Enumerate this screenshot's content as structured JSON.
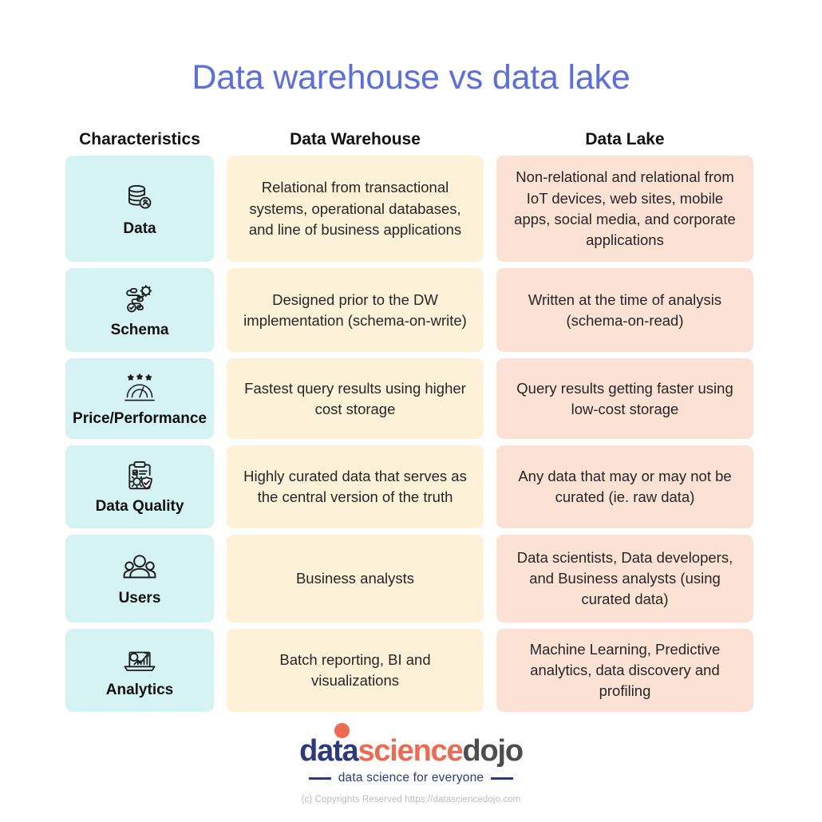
{
  "title": "Data warehouse vs data lake",
  "colors": {
    "title": "#5b6ee1",
    "characteristics_cell": "#d6f3f4",
    "data_warehouse_cell": "#fdf1d8",
    "data_lake_cell": "#fbe2d4",
    "logo_navy": "#2b3a80",
    "logo_orange": "#ee6a50",
    "logo_gray": "#4d4d4d"
  },
  "headers": {
    "characteristics": "Characteristics",
    "data_warehouse": "Data Warehouse",
    "data_lake": "Data Lake"
  },
  "rows": [
    {
      "icon": "database-icon",
      "characteristic": "Data",
      "data_warehouse": "Relational from transactional systems, operational databases, and line of business applications",
      "data_lake": "Non-relational and relational from IoT devices, web sites, mobile apps, social media, and corporate applications"
    },
    {
      "icon": "schema-workflow-icon",
      "characteristic": "Schema",
      "data_warehouse": "Designed prior to the DW implementation (schema-on-write)",
      "data_lake": "Written at the time of analysis (schema-on-read)"
    },
    {
      "icon": "gauge-stars-icon",
      "characteristic": "Price/Performance",
      "data_warehouse": "Fastest query results using higher cost storage",
      "data_lake": "Query results getting faster using low-cost storage"
    },
    {
      "icon": "clipboard-shield-icon",
      "characteristic": "Data Quality",
      "data_warehouse": "Highly curated data that serves as the central version of the truth",
      "data_lake": "Any data that may or may not be curated (ie. raw data)"
    },
    {
      "icon": "users-group-icon",
      "characteristic": "Users",
      "data_warehouse": "Business analysts",
      "data_lake": "Data scientists, Data developers, and Business analysts (using curated data)"
    },
    {
      "icon": "analytics-laptop-icon",
      "characteristic": "Analytics",
      "data_warehouse": "Batch reporting, BI and visualizations",
      "data_lake": "Machine Learning, Predictive analytics, data discovery and profiling"
    }
  ],
  "footer": {
    "logo_part1": "data",
    "logo_part2": "science",
    "logo_part3": "dojo",
    "tagline": "data science for everyone",
    "copyright": "(c) Copyrights Reserved  https://datasciencedojo.com"
  }
}
